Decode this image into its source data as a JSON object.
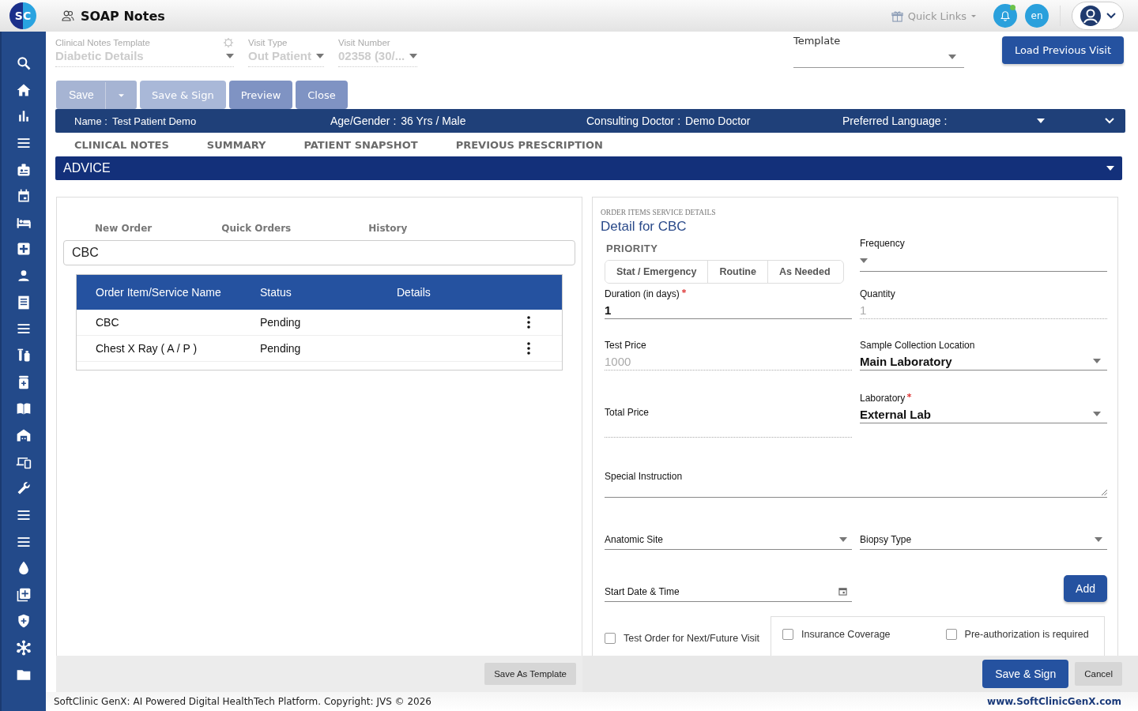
{
  "app": {
    "logo": "SC",
    "title": "SOAP Notes",
    "quick_links": "Quick Links",
    "notification_unread": true,
    "language": "en"
  },
  "header_fields": [
    {
      "label": "Clinical Notes Template",
      "value": "Diabetic Details",
      "disabled": true,
      "kind": "select-gear"
    },
    {
      "label": "Visit Type",
      "value": "Out Patient",
      "disabled": true,
      "kind": "select"
    },
    {
      "label": "Visit Number",
      "value": "02358 (30/...",
      "disabled": true,
      "kind": "select"
    }
  ],
  "template_field": {
    "label": "Template"
  },
  "load_previous_button": "Load Previous Visit",
  "toolbar": [
    {
      "label": "Save",
      "disabled": true,
      "kind": "split"
    },
    {
      "label": "Save & Sign",
      "disabled": true,
      "kind": "plain"
    },
    {
      "label": "Preview",
      "disabled": false,
      "kind": "plain"
    },
    {
      "label": "Close",
      "disabled": false,
      "kind": "plain"
    }
  ],
  "patient_bar": [
    {
      "label": "Name :",
      "value": "Test Patient Demo",
      "kind": "text"
    },
    {
      "label": "Age/Gender :",
      "value": "36 Yrs / Male",
      "kind": "text"
    },
    {
      "label": "Consulting Doctor :",
      "value": "Demo Doctor",
      "kind": "text"
    },
    {
      "label": "Preferred Language :",
      "kind": "select"
    }
  ],
  "tabs": [
    "CLINICAL NOTES",
    "SUMMARY",
    "PATIENT SNAPSHOT",
    "PREVIOUS PRESCRIPTION"
  ],
  "section_title": "ADVICE",
  "order_panel": {
    "tabs": [
      "New Order",
      "Quick Orders",
      "History"
    ],
    "search_value": "CBC",
    "columns": [
      "Order Item/Service Name",
      "Status",
      "Details"
    ],
    "rows": [
      {
        "name": "CBC",
        "status": "Pending"
      },
      {
        "name": "Chest X Ray ( A / P )",
        "status": "Pending"
      }
    ],
    "save_template_button": "Save As Template"
  },
  "detail": {
    "caption": "ORDER ITEMS SERVICE DETAILS",
    "title": "Detail for CBC",
    "priority": {
      "label": "PRIORITY",
      "options": [
        {
          "label": "Stat / Emergency",
          "selected": false
        },
        {
          "label": "Routine",
          "selected": false
        },
        {
          "label": "As Needed",
          "selected": false
        }
      ]
    },
    "frequency": {
      "label": "Frequency",
      "kind": "select"
    },
    "duration": {
      "label": "Duration (in days)",
      "value": "1",
      "required": true,
      "disabled": false
    },
    "quantity": {
      "label": "Quantity",
      "value": "1",
      "disabled": true
    },
    "test_price": {
      "label": "Test Price",
      "value": "1000",
      "disabled": true
    },
    "sample_location": {
      "label": "Sample Collection Location",
      "value": "Main Laboratory",
      "disabled": false,
      "kind": "select"
    },
    "total_price": {
      "label": "Total Price",
      "disabled": true
    },
    "laboratory": {
      "label": "Laboratory",
      "value": "External Lab",
      "required": true,
      "disabled": false,
      "kind": "select"
    },
    "special_instruction": {
      "label": "Special Instruction"
    },
    "anatomic_site": {
      "label": "Anatomic Site"
    },
    "biopsy_type": {
      "label": "Biopsy Type"
    },
    "start_date": {
      "label": "Start Date & Time"
    },
    "add_button": "Add",
    "checkboxes": [
      {
        "label": "Test Order for Next/Future Visit",
        "checked": false
      },
      {
        "label": "Insurance Coverage",
        "checked": false
      },
      {
        "label": "Pre-authorization is required",
        "checked": false
      }
    ],
    "save_sign_button": "Save & Sign",
    "cancel_button": "Cancel"
  },
  "footer": {
    "copyright": "SoftClinic GenX: AI Powered Digital HealthTech Platform. Copyright: JVS © 2026",
    "website": "www.SoftClinicGenX.com"
  }
}
